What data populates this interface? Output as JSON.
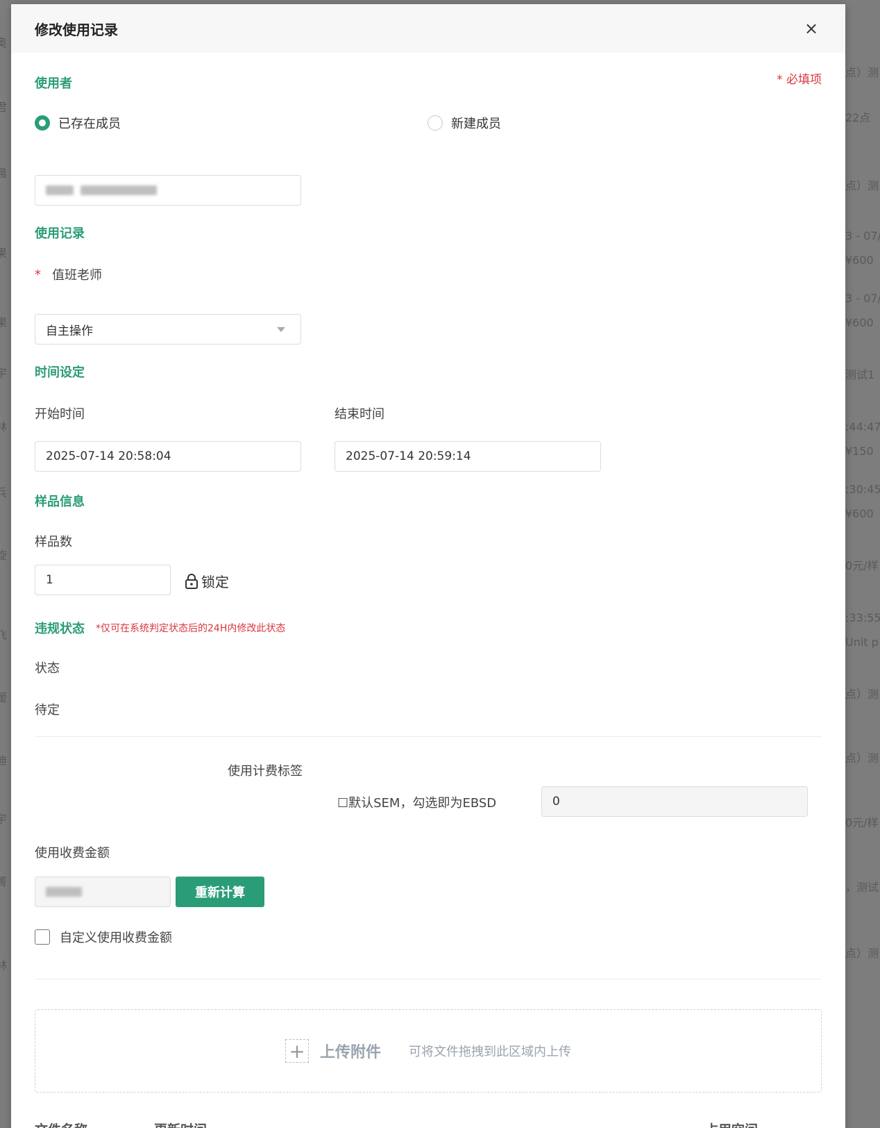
{
  "modal": {
    "title": "修改使用记录",
    "close_symbol": "×",
    "required_note": "* 必填项"
  },
  "user_section": {
    "title": "使用者",
    "radio_existing": "已存在成员",
    "radio_new": "新建成员",
    "selected": "existing"
  },
  "record_section": {
    "title": "使用记录",
    "teacher_required_star": "*",
    "teacher_label": "值班老师",
    "teacher_value": "自主操作"
  },
  "time_section": {
    "title": "时间设定",
    "start_label": "开始时间",
    "start_value": "2025-07-14 20:58:04",
    "end_label": "结束时间",
    "end_value": "2025-07-14 20:59:14"
  },
  "sample_section": {
    "title": "样品信息",
    "count_label": "样品数",
    "count_value": "1",
    "lock_label": "锁定"
  },
  "violation_section": {
    "title": "违规状态",
    "note": "*仅可在系统判定状态后的24H内修改此状态",
    "status_label": "状态",
    "status_value": "待定"
  },
  "billing": {
    "tag_label": "使用计费标签",
    "sem_checkbox_label": "☐默认SEM，勾选即为EBSD",
    "tag_value": "0",
    "fee_label": "使用收费金额",
    "recalc_button": "重新计算",
    "custom_fee_label": "自定义使用收费金额"
  },
  "upload": {
    "plus": "+",
    "label": "上传附件",
    "hint": "可将文件拖拽到此区域内上传"
  },
  "file_table": {
    "headers": [
      "文件名称",
      "更新时间",
      "占用空间"
    ]
  },
  "background_fragments": {
    "right": [
      "点）测",
      "22点",
      "点）测",
      "3 - 07/",
      "¥600",
      "3 - 07/",
      "¥600",
      "测试1",
      ":44:47",
      "¥150",
      ":30:45",
      "¥600",
      "0元/样",
      ":33:55",
      "Unit p",
      "点）测",
      "点）测",
      "0元/样",
      "，测试",
      "点）测"
    ],
    "left": [
      "奥",
      "君",
      "晨",
      "果",
      "果",
      "宇",
      "林",
      "兵",
      "旋",
      "飞",
      "媛",
      "迪",
      "宇",
      "菁",
      "林"
    ]
  },
  "colors": {
    "accent": "#2a9d78",
    "required": "#d9363e"
  }
}
